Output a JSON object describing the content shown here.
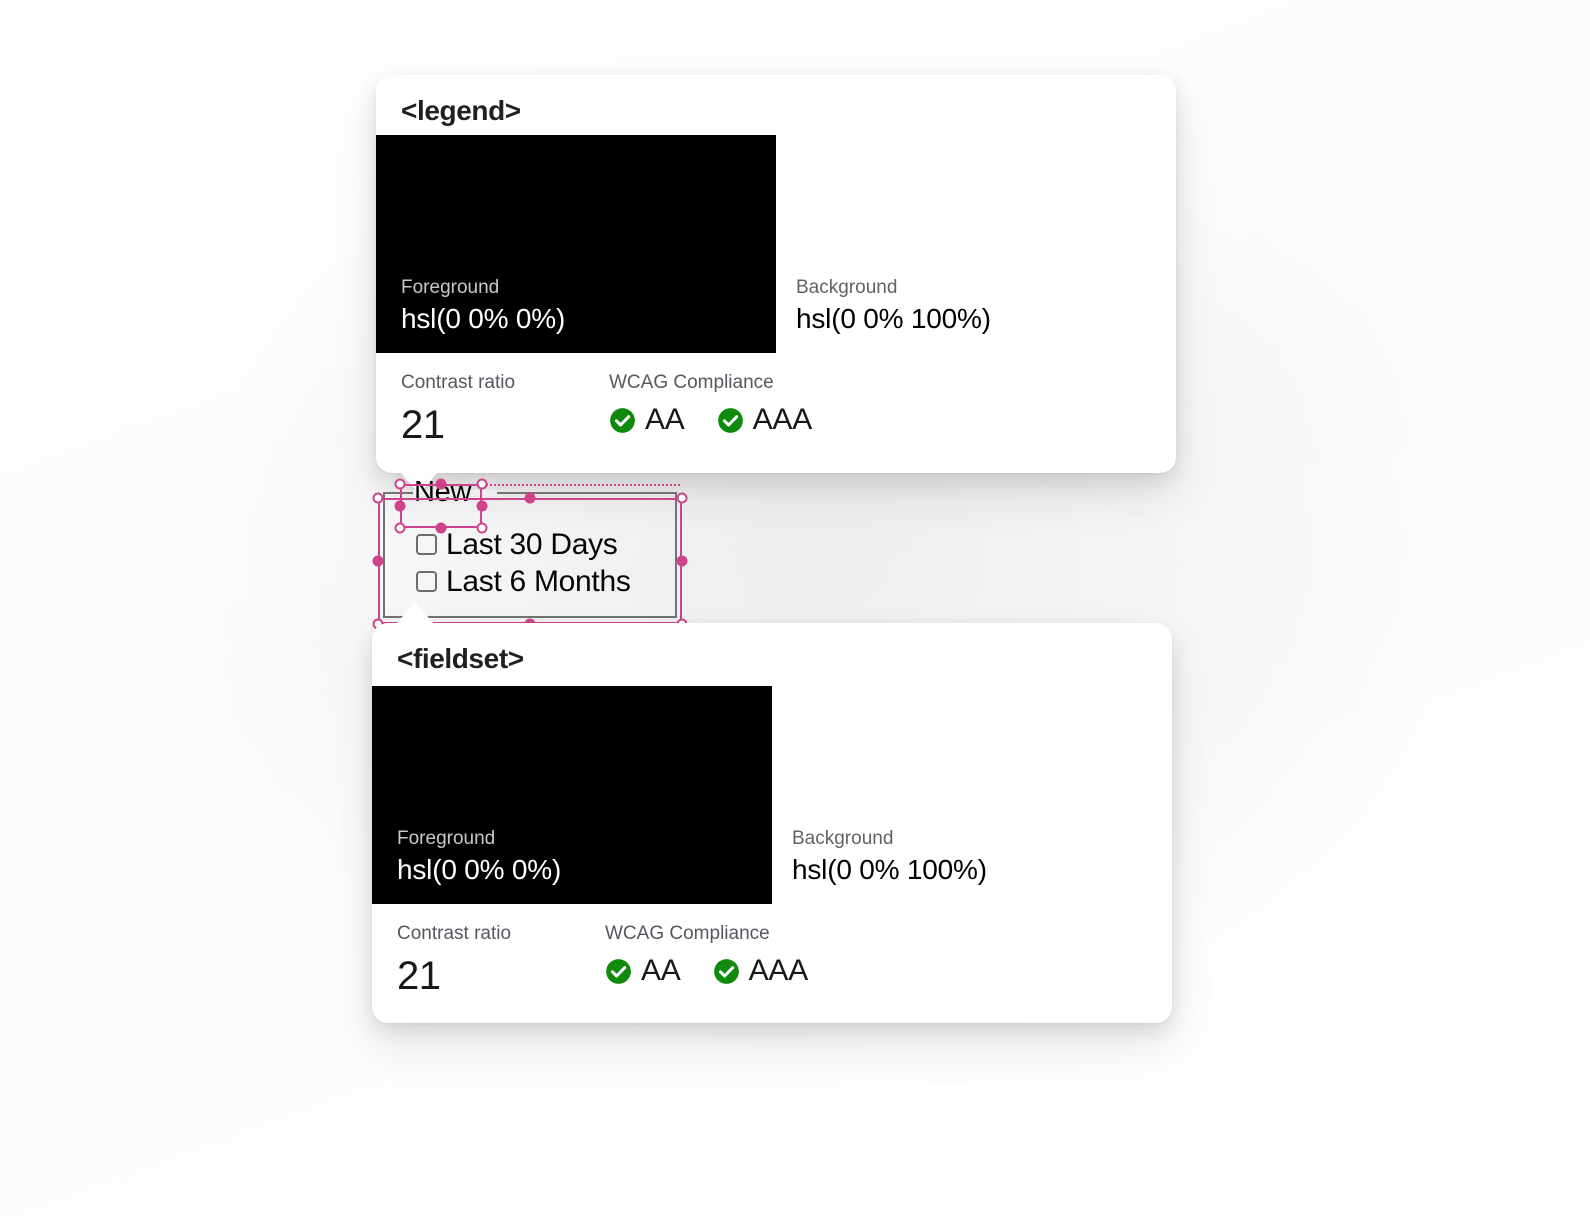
{
  "theme": {
    "accent_pink": "#d0438c",
    "check_green": "#108a0c",
    "card_bg": "#ffffff",
    "page_bg": "#ffffff",
    "swatch_fg_color": "#000000",
    "swatch_bg_color": "#ffffff"
  },
  "cards": [
    {
      "id": "legend",
      "title": "<legend>",
      "foreground": {
        "label": "Foreground",
        "value": "hsl(0 0% 0%)"
      },
      "background": {
        "label": "Background",
        "value": "hsl(0 0% 100%)"
      },
      "contrast": {
        "label": "Contrast ratio",
        "value": "21"
      },
      "wcag": {
        "label": "WCAG Compliance",
        "badges": [
          {
            "level": "AA",
            "icon": "check-circle-icon",
            "passed": true
          },
          {
            "level": "AAA",
            "icon": "check-circle-icon",
            "passed": true
          }
        ]
      }
    },
    {
      "id": "fieldset",
      "title": "<fieldset>",
      "foreground": {
        "label": "Foreground",
        "value": "hsl(0 0% 0%)"
      },
      "background": {
        "label": "Background",
        "value": "hsl(0 0% 100%)"
      },
      "contrast": {
        "label": "Contrast ratio",
        "value": "21"
      },
      "wcag": {
        "label": "WCAG Compliance",
        "badges": [
          {
            "level": "AA",
            "icon": "check-circle-icon",
            "passed": true
          },
          {
            "level": "AAA",
            "icon": "check-circle-icon",
            "passed": true
          }
        ]
      }
    }
  ],
  "inspected_form": {
    "legend": "New",
    "checkboxes": [
      {
        "label": "Last 30 Days",
        "checked": false
      },
      {
        "label": "Last 6 Months",
        "checked": false
      }
    ]
  }
}
